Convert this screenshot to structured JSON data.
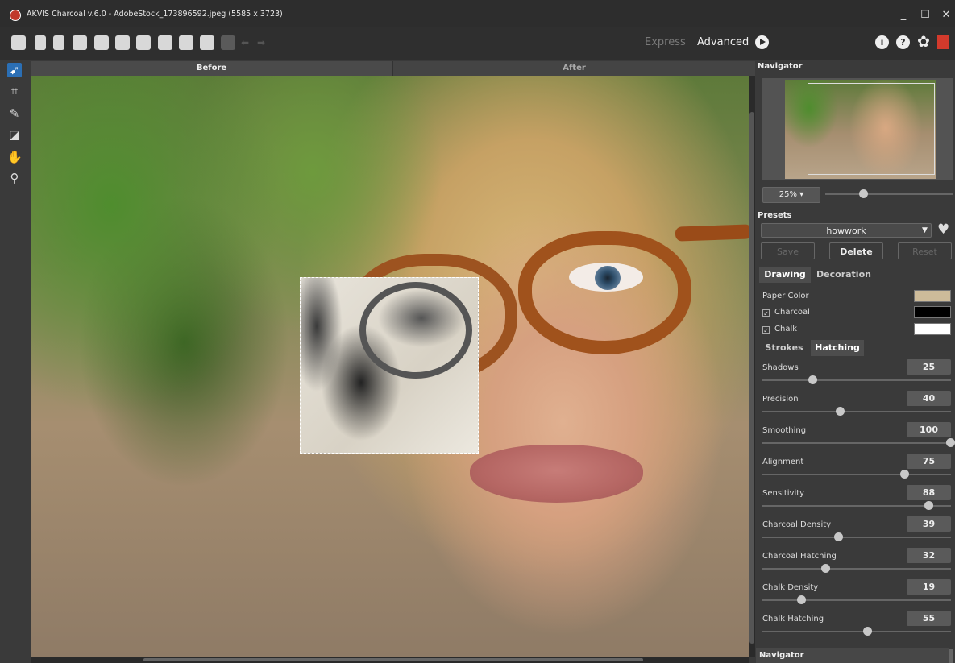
{
  "window": {
    "title": "AKVIS Charcoal v.6.0 - AdobeStock_173896592.jpeg (5585 x 3723)",
    "minimize": "_",
    "maximize": "☐",
    "close": "✕"
  },
  "toolbar": {
    "mode_express": "Express",
    "mode_advanced": "Advanced",
    "info_icon": "i",
    "help_icon": "?",
    "settings_icon": "✿"
  },
  "left_tools": {
    "tools": [
      "direction-tool-icon",
      "crop-icon",
      "pencil-icon",
      "eraser-icon",
      "hand-icon",
      "zoom-icon"
    ]
  },
  "canvas_tabs": {
    "before": "Before",
    "after": "After"
  },
  "navigator": {
    "title": "Navigator",
    "zoom": "25% ▾",
    "zoom_level": 0.3
  },
  "presets": {
    "title": "Presets",
    "selected": "howwork",
    "save": "Save",
    "delete": "Delete",
    "reset": "Reset"
  },
  "settings_tabs": {
    "drawing": "Drawing",
    "decoration": "Decoration"
  },
  "colors": {
    "paper_color_label": "Paper Color",
    "paper_color": "#cdbb9a",
    "charcoal_label": "Charcoal",
    "charcoal_color": "#000000",
    "chalk_label": "Chalk",
    "chalk_color": "#ffffff",
    "accent": "#2b6fb5"
  },
  "stroke_tabs": {
    "strokes": "Strokes",
    "hatching": "Hatching"
  },
  "params": [
    {
      "label": "Shadows",
      "value": "25",
      "level": 0.25
    },
    {
      "label": "Precision",
      "value": "40",
      "level": 0.4
    },
    {
      "label": "Smoothing",
      "value": "100",
      "level": 1.0
    },
    {
      "label": "Alignment",
      "value": "75",
      "level": 0.75
    },
    {
      "label": "Sensitivity",
      "value": "88",
      "level": 0.88
    },
    {
      "label": "Charcoal Density",
      "value": "39",
      "level": 0.39
    },
    {
      "label": "Charcoal Hatching",
      "value": "32",
      "level": 0.32
    },
    {
      "label": "Chalk Density",
      "value": "19",
      "level": 0.19
    },
    {
      "label": "Chalk Hatching",
      "value": "55",
      "level": 0.55
    }
  ],
  "bottom_panel": {
    "title": "Navigator"
  }
}
